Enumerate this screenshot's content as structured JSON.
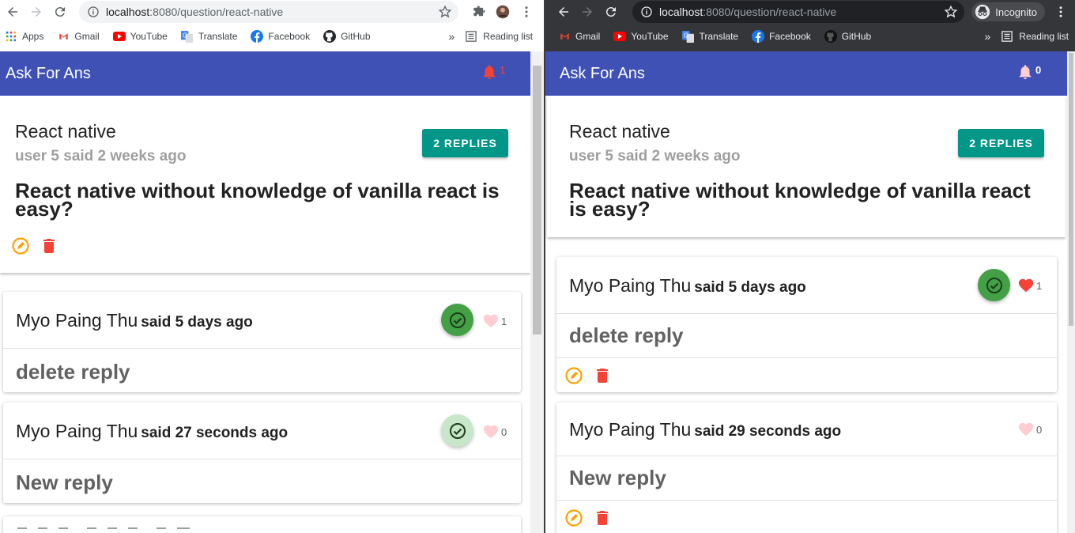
{
  "browser_left": {
    "url_host": "localhost",
    "url_path": ":8080/question/react-native",
    "bookmarks": [
      "Apps",
      "Gmail",
      "YouTube",
      "Translate",
      "Facebook",
      "GitHub"
    ],
    "more": "»",
    "reading_list": "Reading list"
  },
  "browser_right": {
    "url_host": "localhost",
    "url_path": ":8080/question/react-native",
    "profile": "Incognito",
    "bookmarks": [
      "Gmail",
      "YouTube",
      "Translate",
      "Facebook",
      "GitHub"
    ],
    "more": "»",
    "reading_list": "Reading list"
  },
  "app": {
    "title": "Ask For Ans",
    "colors": {
      "primary": "#3f51b5",
      "teal": "#009688",
      "accept_green": "#43a047",
      "heart_red": "#f44336",
      "edit_orange": "#ffa000"
    }
  },
  "left": {
    "notification_count": "1",
    "question": {
      "title": "React native",
      "meta": "user 5 said 2 weeks ago",
      "body": "React native without knowledge of vanilla react is easy?",
      "replies_button": "2 REPLIES"
    },
    "replies": [
      {
        "author": "Myo Paing Thu",
        "time": "said 5 days ago",
        "body": "delete reply",
        "likes": "1",
        "accepted": true
      },
      {
        "author": "Myo Paing Thu",
        "time": "said 27 seconds ago",
        "body": "New reply",
        "likes": "0",
        "accepted": false
      }
    ]
  },
  "right": {
    "notification_count": "0",
    "question": {
      "title": "React native",
      "meta": "user 5 said 2 weeks ago",
      "body": "React native without knowledge of vanilla react is easy?",
      "replies_button": "2 REPLIES"
    },
    "replies": [
      {
        "author": "Myo Paing Thu",
        "time": "said 5 days ago",
        "body": "delete reply",
        "likes": "1",
        "accepted": true
      },
      {
        "author": "Myo Paing Thu",
        "time": "said 29 seconds ago",
        "body": "New reply",
        "likes": "0",
        "accepted": false
      }
    ]
  }
}
